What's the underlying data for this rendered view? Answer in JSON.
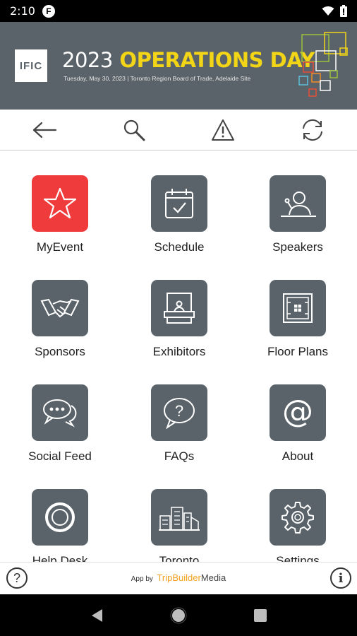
{
  "status_bar": {
    "time": "2:10",
    "app_badge": "F"
  },
  "banner": {
    "logo_text": "IFIC",
    "title_year": "2023",
    "title_main": "OPERATIONS DAY",
    "subtitle": "Tuesday, May 30, 2023 | Toronto Region Board of Trade, Adelaide Site",
    "accent_color": "#f2d516"
  },
  "toolbar": {
    "back_icon": "back-arrow-icon",
    "search_icon": "search-icon",
    "alert_icon": "warning-icon",
    "refresh_icon": "refresh-icon"
  },
  "tiles": [
    {
      "label": "MyEvent",
      "icon": "star-icon",
      "color": "#ef3b3b"
    },
    {
      "label": "Schedule",
      "icon": "calendar-check-icon",
      "color": "#5a6369"
    },
    {
      "label": "Speakers",
      "icon": "speaker-podium-icon",
      "color": "#5a6369"
    },
    {
      "label": "Sponsors",
      "icon": "handshake-icon",
      "color": "#5a6369"
    },
    {
      "label": "Exhibitors",
      "icon": "booth-icon",
      "color": "#5a6369"
    },
    {
      "label": "Floor Plans",
      "icon": "floor-plan-icon",
      "color": "#5a6369"
    },
    {
      "label": "Social Feed",
      "icon": "chat-bubbles-icon",
      "color": "#5a6369"
    },
    {
      "label": "FAQs",
      "icon": "question-bubble-icon",
      "color": "#5a6369"
    },
    {
      "label": "About",
      "icon": "at-sign-icon",
      "color": "#5a6369"
    },
    {
      "label": "Help Desk",
      "icon": "lifebuoy-icon",
      "color": "#5a6369"
    },
    {
      "label": "Toronto",
      "icon": "city-buildings-icon",
      "color": "#5a6369"
    },
    {
      "label": "Settings",
      "icon": "gear-icon",
      "color": "#5a6369"
    }
  ],
  "footer": {
    "help_label": "?",
    "info_label": "i",
    "credit_prefix": "App by",
    "brand_part1": "TripBuilder",
    "brand_part2": "Media"
  }
}
